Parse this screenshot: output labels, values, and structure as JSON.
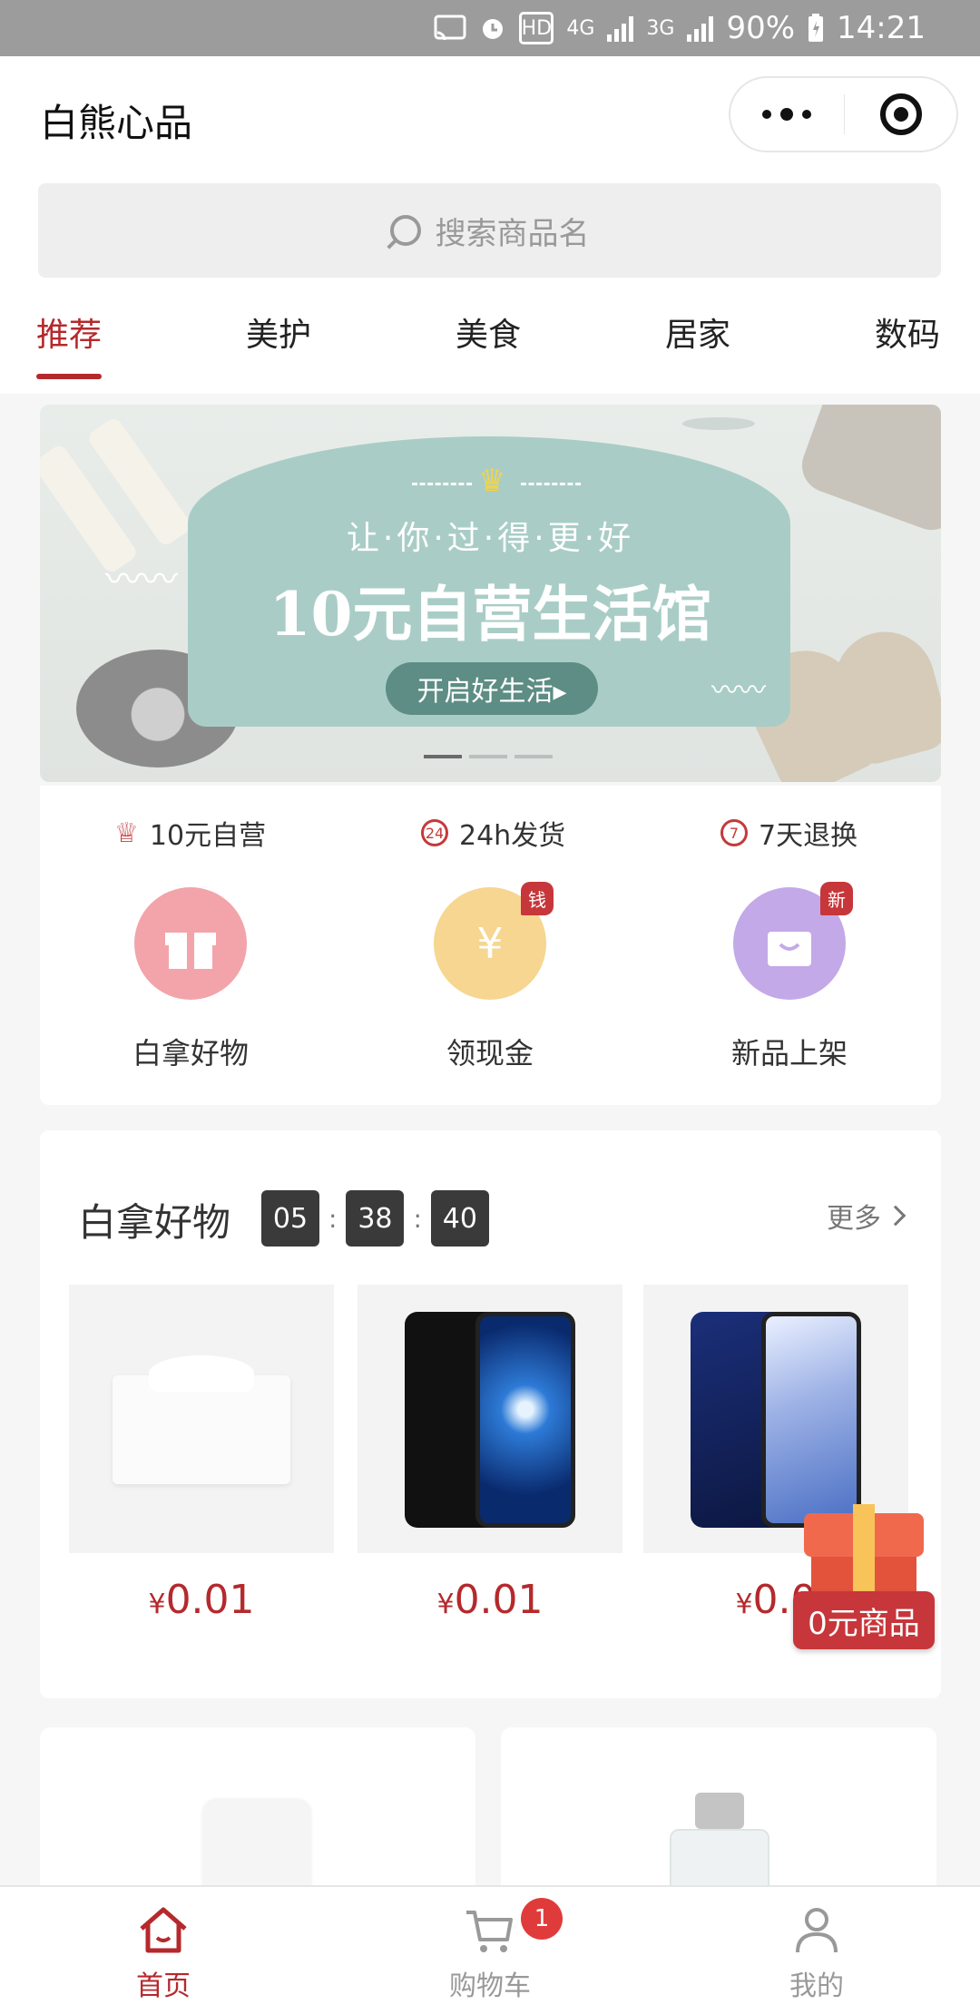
{
  "status_bar": {
    "network_4g": "4G",
    "network_3g": "3G",
    "hd_badge": "HD",
    "battery": "90%",
    "time": "14:21"
  },
  "header": {
    "title": "白熊心品"
  },
  "search": {
    "placeholder": "搜索商品名"
  },
  "tabs": [
    {
      "label": "推荐",
      "active": true
    },
    {
      "label": "美护",
      "active": false
    },
    {
      "label": "美食",
      "active": false
    },
    {
      "label": "居家",
      "active": false
    },
    {
      "label": "数码",
      "active": false
    }
  ],
  "banner": {
    "slogan": "让·你·过·得·更·好",
    "headline": "10元自营生活馆",
    "cta": "开启好生活▸",
    "slide_count": 3,
    "active_slide": 1
  },
  "promises": [
    {
      "icon": "crown-icon",
      "label": "10元自营"
    },
    {
      "icon": "24h-icon",
      "label": "24h发货"
    },
    {
      "icon": "7day-icon",
      "label": "7天退换"
    }
  ],
  "entries": [
    {
      "icon": "gift-icon",
      "label": "白拿好物",
      "tag": ""
    },
    {
      "icon": "coin-icon",
      "glyph": "¥",
      "label": "领现金",
      "tag": "钱"
    },
    {
      "icon": "bag-icon",
      "label": "新品上架",
      "tag": "新"
    }
  ],
  "free_section": {
    "title": "白拿好物",
    "countdown": {
      "hours": "05",
      "minutes": "38",
      "seconds": "40",
      "separator": ":"
    },
    "more_label": "更多",
    "items": [
      {
        "name": "tissue",
        "currency": "¥",
        "price": "0.01"
      },
      {
        "name": "honor-phone",
        "currency": "¥",
        "price": "0.01"
      },
      {
        "name": "vivo-phone",
        "currency": "¥",
        "price": "0.0"
      }
    ]
  },
  "floating_badge": {
    "label": "0元商品"
  },
  "bottom_nav": [
    {
      "icon": "home-icon",
      "label": "首页",
      "active": true
    },
    {
      "icon": "cart-icon",
      "label": "购物车",
      "active": false,
      "badge": "1"
    },
    {
      "icon": "user-icon",
      "label": "我的",
      "active": false
    }
  ],
  "colors": {
    "accent": "#b5292c",
    "banner_panel": "#a9cdc6",
    "countdown_bg": "#3a3a3a"
  }
}
